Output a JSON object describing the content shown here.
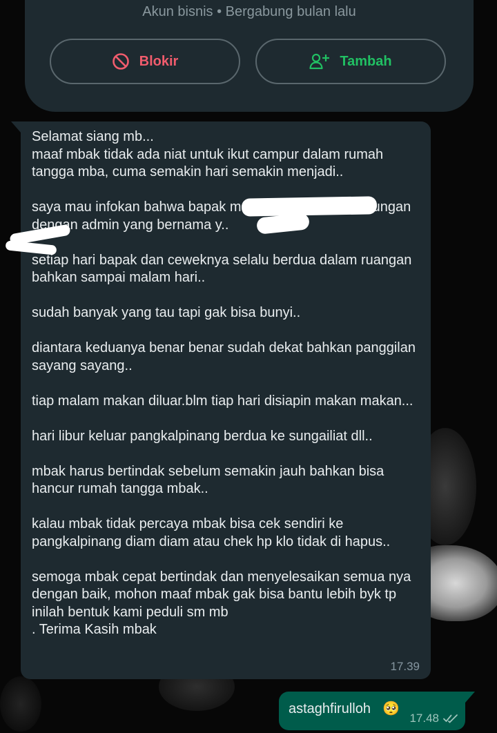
{
  "profile": {
    "subtitle": "Akun bisnis • Bergabung bulan lalu",
    "block_label": "Blokir",
    "add_label": "Tambah"
  },
  "chat": {
    "incoming": {
      "paragraphs": [
        "Selamat siang mb...\nmaaf mbak tidak ada niat untuk ikut campur dalam rumah tangga mba, cuma semakin hari semakin menjadi..",
        "saya mau infokan bahwa bapak m                         sedang menjalin hubungan dengan admin              yang bernama              y..",
        "setiap hari bapak dan ceweknya selalu berdua dalam ruangan bahkan sampai malam hari..",
        "sudah banyak yang tau tapi gak bisa bunyi..",
        "diantara keduanya benar benar sudah dekat bahkan panggilan sayang sayang..",
        "tiap malam makan diluar.blm tiap hari disiapin makan makan...",
        "hari libur keluar pangkalpinang berdua ke sungailiat dll..",
        "mbak harus bertindak sebelum semakin jauh bahkan bisa hancur rumah tangga mbak..",
        "kalau mbak tidak percaya mbak bisa cek sendiri ke pangkalpinang diam diam atau chek hp klo tidak di hapus..",
        "semoga mbak cepat bertindak dan menyelesaikan semua nya dengan baik, mohon maaf mbak gak bisa bantu lebih byk tp inilah bentuk kami peduli sm mb\n. Terima Kasih mbak"
      ],
      "time": "17.39"
    },
    "outgoing": {
      "text": "astaghfirulloh",
      "emoji": "🥺",
      "time": "17.48",
      "status_icon": "double-check-icon"
    }
  },
  "colors": {
    "card_bg": "#1e2a30",
    "block_red": "#f15c6d",
    "add_green": "#21c063",
    "outgoing_bg": "#005c4b"
  }
}
